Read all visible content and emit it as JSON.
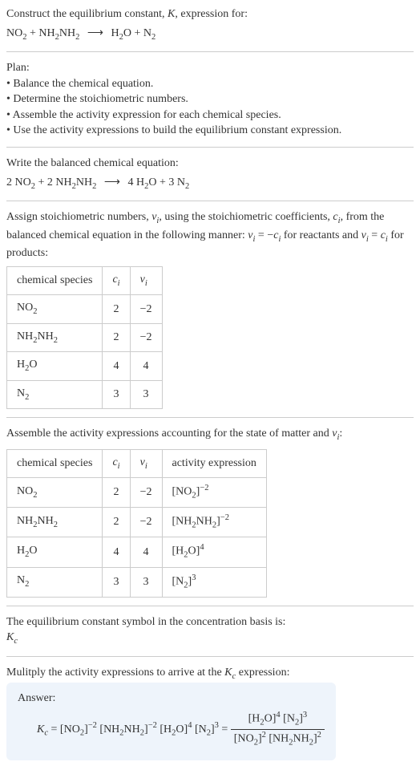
{
  "intro": {
    "line1_pre": "Construct the equilibrium constant, ",
    "line1_K": "K",
    "line1_post": ", expression for:",
    "eq_lhs1": "NO",
    "eq_lhs1_sub": "2",
    "eq_lhs2": "NH",
    "eq_lhs2_sub1": "2",
    "eq_lhs2_mid": "NH",
    "eq_lhs2_sub2": "2",
    "eq_rhs1": "H",
    "eq_rhs1_sub": "2",
    "eq_rhs1_mid": "O",
    "eq_rhs2": "N",
    "eq_rhs2_sub": "2",
    "arrow": "⟶"
  },
  "plan": {
    "heading": "Plan:",
    "b1": "• Balance the chemical equation.",
    "b2": "• Determine the stoichiometric numbers.",
    "b3": "• Assemble the activity expression for each chemical species.",
    "b4": "• Use the activity expressions to build the equilibrium constant expression."
  },
  "balanced": {
    "heading": "Write the balanced chemical equation:",
    "c1": "2",
    "c2": "2",
    "c3": "4",
    "c4": "3"
  },
  "stoich": {
    "text_pre": "Assign stoichiometric numbers, ",
    "nu": "ν",
    "nu_sub": "i",
    "text_mid1": ", using the stoichiometric coefficients, ",
    "c": "c",
    "c_sub": "i",
    "text_mid2": ", from the balanced chemical equation in the following manner: ",
    "rel1_lhs": "ν",
    "rel1_eq": " = −",
    "rel1_rhs": "c",
    "text_mid3": " for reactants and ",
    "rel2_eq": " = ",
    "text_post": " for products:"
  },
  "table1": {
    "h1": "chemical species",
    "h2_sym": "c",
    "h2_sub": "i",
    "h3_sym": "ν",
    "h3_sub": "i",
    "rows": [
      {
        "sp": "NO",
        "sp_sub": "2",
        "c": "2",
        "v": "−2"
      },
      {
        "sp": "NH",
        "sp_sub": "2",
        "sp2": "NH",
        "sp_sub2": "2",
        "c": "2",
        "v": "−2"
      },
      {
        "sp": "H",
        "sp_sub": "2",
        "sp2": "O",
        "c": "4",
        "v": "4"
      },
      {
        "sp": "N",
        "sp_sub": "2",
        "c": "3",
        "v": "3"
      }
    ]
  },
  "activity": {
    "heading_pre": "Assemble the activity expressions accounting for the state of matter and ",
    "heading_sym": "ν",
    "heading_sub": "i",
    "heading_post": ":"
  },
  "table2": {
    "h1": "chemical species",
    "h2_sym": "c",
    "h2_sub": "i",
    "h3_sym": "ν",
    "h3_sub": "i",
    "h4": "activity expression",
    "rows": [
      {
        "sp": "NO",
        "sp_sub": "2",
        "c": "2",
        "v": "−2",
        "a_base": "[NO",
        "a_sub": "2",
        "a_close": "]",
        "a_sup": "−2"
      },
      {
        "sp": "NH",
        "sp_sub": "2",
        "sp2": "NH",
        "sp_sub2": "2",
        "c": "2",
        "v": "−2",
        "a_base": "[NH",
        "a_sub": "2",
        "a_mid": "NH",
        "a_sub2": "2",
        "a_close": "]",
        "a_sup": "−2"
      },
      {
        "sp": "H",
        "sp_sub": "2",
        "sp2": "O",
        "c": "4",
        "v": "4",
        "a_base": "[H",
        "a_sub": "2",
        "a_mid": "O]",
        "a_sup": "4"
      },
      {
        "sp": "N",
        "sp_sub": "2",
        "c": "3",
        "v": "3",
        "a_base": "[N",
        "a_sub": "2",
        "a_close": "]",
        "a_sup": "3"
      }
    ]
  },
  "symbol": {
    "line": "The equilibrium constant symbol in the concentration basis is:",
    "K": "K",
    "K_sub": "c"
  },
  "final": {
    "line_pre": "Mulitply the activity expressions to arrive at the ",
    "K": "K",
    "K_sub": "c",
    "line_post": " expression:",
    "answer_label": "Answer:",
    "eq_pre": " = ",
    "t1": "[NO",
    "t1s": "2",
    "t1c": "]",
    "t1e": "−2",
    "t2": "[NH",
    "t2s": "2",
    "t2m": "NH",
    "t2s2": "2",
    "t2c": "]",
    "t2e": "−2",
    "t3": "[H",
    "t3s": "2",
    "t3m": "O]",
    "t3e": "4",
    "t4": "[N",
    "t4s": "2",
    "t4c": "]",
    "t4e": "3",
    "num1": "[H",
    "num1s": "2",
    "num1m": "O]",
    "num1e": "4",
    "num2": "[N",
    "num2s": "2",
    "num2c": "]",
    "num2e": "3",
    "den1": "[NO",
    "den1s": "2",
    "den1c": "]",
    "den1e": "2",
    "den2": "[NH",
    "den2s": "2",
    "den2m": "NH",
    "den2s2": "2",
    "den2c": "]",
    "den2e": "2"
  }
}
